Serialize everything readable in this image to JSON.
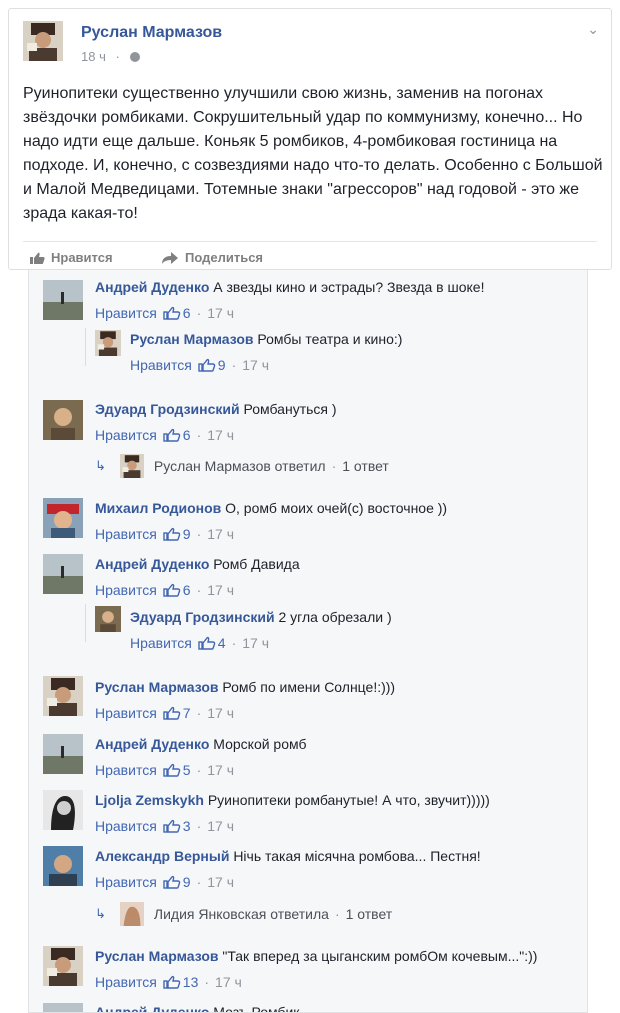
{
  "post": {
    "author": "Руслан Мармазов",
    "time": "18 ч",
    "text": "Руинопитеки существенно улучшили свою жизнь, заменив на погонах звёздочки ромбиками. Сокрушительный удар по коммунизму, конечно... Но надо идти еще дальше. Коньяк 5 ромбиков, 4-ромбиковая гостиница на подходе. И, конечно, с созвездиями надо что-то делать. Особенно с Большой и Малой Медведицами. Тотемные знаки \"агрессоров\" над годовой - это же зрада какая-то!",
    "like_label": "Нравится",
    "share_label": "Поделиться"
  },
  "comments": [
    {
      "name": "Андрей Дуденко",
      "text": "А звезды кино и эстрады? Звезда в шоке!",
      "like": "Нравится",
      "count": "6",
      "time": "17 ч"
    },
    {
      "name": "Руслан Мармазов",
      "text": "Ромбы театра и кино:)",
      "like": "Нравится",
      "count": "9",
      "time": "17 ч"
    },
    {
      "name": "Эдуард Гродзинский",
      "text": "Ромбануться )",
      "like": "Нравится",
      "count": "6",
      "time": "17 ч",
      "reply_summary": {
        "text": "Руслан Мармазов ответил",
        "count": "1 ответ"
      }
    },
    {
      "name": "Михаил Родионов",
      "text": "О, ромб моих очей(с) восточное ))",
      "like": "Нравится",
      "count": "9",
      "time": "17 ч"
    },
    {
      "name": "Андрей Дуденко",
      "text": "Ромб Давида",
      "like": "Нравится",
      "count": "6",
      "time": "17 ч"
    },
    {
      "name": "Эдуард Гродзинский",
      "text": "2 угла обрезали )",
      "like": "Нравится",
      "count": "4",
      "time": "17 ч"
    },
    {
      "name": "Руслан Мармазов",
      "text": "Ромб по имени Солнце!:)))",
      "like": "Нравится",
      "count": "7",
      "time": "17 ч"
    },
    {
      "name": "Андрей Дуденко",
      "text": "Морской ромб",
      "like": "Нравится",
      "count": "5",
      "time": "17 ч"
    },
    {
      "name": "Ljolja Zemskykh",
      "text": "Руинопитеки ромбанутые! А что, звучит)))))",
      "like": "Нравится",
      "count": "3",
      "time": "17 ч"
    },
    {
      "name": "Александр Верный",
      "text": "Нічь такая місячна ромбова... Пестня!",
      "like": "Нравится",
      "count": "9",
      "time": "17 ч",
      "reply_summary": {
        "text": "Лидия Янковская ответила",
        "count": "1 ответ"
      }
    },
    {
      "name": "Руслан Мармазов",
      "text": "\"Так вперед за цыганским ромбОм кочевым...\":))",
      "like": "Нравится",
      "count": "13",
      "time": "17 ч"
    },
    {
      "name": "Андрей Дуденко",
      "text": "Мозъ Ромбик",
      "like": "",
      "count": "",
      "time": ""
    }
  ],
  "colors": {
    "link": "#365899",
    "accent": "#4267b2",
    "muted": "#90949c"
  }
}
